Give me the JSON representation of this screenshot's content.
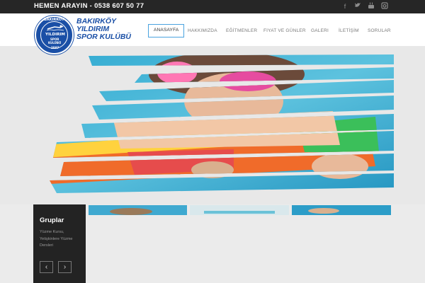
{
  "topbar": {
    "phone_text": "HEMEN ARAYIN - 0538 607 50 77",
    "social_icons": [
      "facebook-icon",
      "twitter-icon",
      "youtube-icon",
      "instagram-icon"
    ]
  },
  "logo": {
    "arc_top": "BAKIRKÖY",
    "center_line_1": "YILDIRIM",
    "center_line_2": "SPOR",
    "center_line_3": "KULÜBÜ",
    "year": "2007",
    "text_line_1": "BAKIRKÖY",
    "text_line_2": "YILDIRIM",
    "text_line_3": "SPOR  KULÜBÜ"
  },
  "nav": {
    "items": [
      {
        "label": "ANASAYFA",
        "active": true
      },
      {
        "label": "HAKKIMIZDA",
        "active": false
      },
      {
        "label": "EĞİTMENLER",
        "active": false
      },
      {
        "label": "FIYAT VE GÜNLER",
        "active": false
      },
      {
        "label": "GALERI",
        "active": false
      },
      {
        "label": "İLETİŞİM",
        "active": false
      },
      {
        "label": "SORULAR",
        "active": false
      }
    ]
  },
  "groups": {
    "title": "Gruplar",
    "description": "Yüzme Kursu, Yetişkinlere Yüzme Dersleri",
    "prev_label": "‹",
    "next_label": "›"
  },
  "colors": {
    "accent": "#4aa3df",
    "brand_blue": "#1a4fa6",
    "topbar": "#262626",
    "panel": "#232323"
  }
}
